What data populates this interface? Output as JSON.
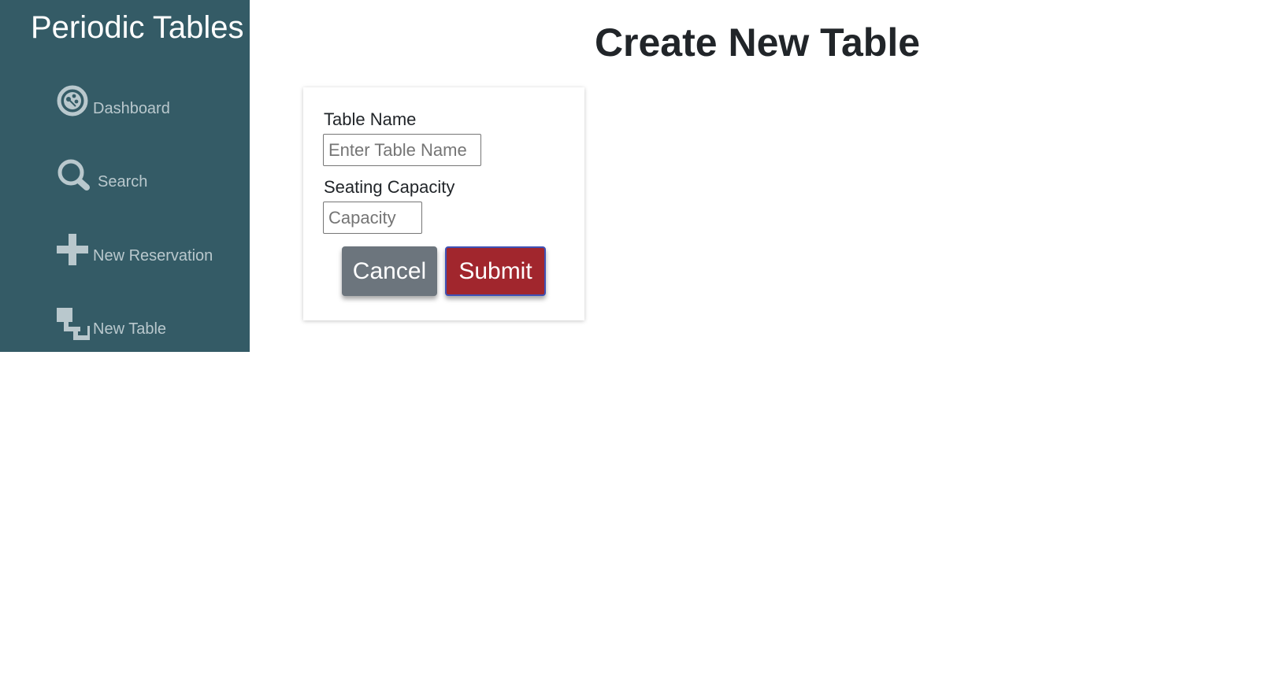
{
  "app": {
    "brand": "Periodic Tables"
  },
  "sidebar": {
    "items": [
      {
        "label": "Dashboard",
        "icon": "dashboard-icon"
      },
      {
        "label": "Search",
        "icon": "search-icon"
      },
      {
        "label": "New Reservation",
        "icon": "plus-icon"
      },
      {
        "label": "New Table",
        "icon": "new-table-icon"
      }
    ],
    "colors": {
      "background": "#345b66",
      "icon": "#b9c8cd"
    }
  },
  "main": {
    "title": "Create New Table"
  },
  "form": {
    "table_name": {
      "label": "Table Name",
      "value": "",
      "placeholder": "Enter Table Name"
    },
    "capacity": {
      "label": "Seating Capacity",
      "value": "",
      "placeholder": "Capacity"
    },
    "cancel_label": "Cancel",
    "submit_label": "Submit",
    "colors": {
      "cancel": "#6c757d",
      "submit": "#a1262d",
      "submit_border": "#3f51b5"
    }
  }
}
